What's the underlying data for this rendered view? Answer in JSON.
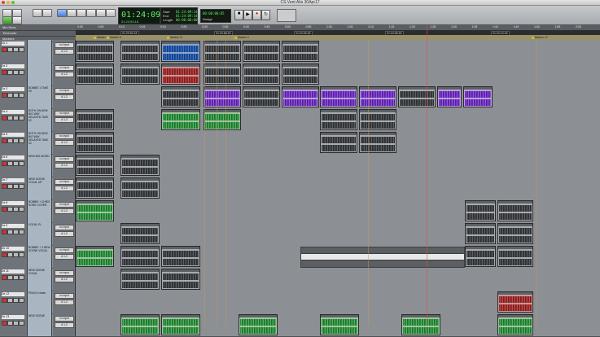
{
  "window": {
    "title": "CS Vent Alts 30Apr17"
  },
  "counter": {
    "main": "01:24:09:14",
    "sub": "01:23:53:18"
  },
  "selection": {
    "start_label": "Start",
    "end_label": "End",
    "length_label": "Length",
    "start": "01:24:09:14",
    "end": "01:24:09:14",
    "length": "00:00:00:00"
  },
  "nudge": {
    "value": "00:00:00:05",
    "label": "Nudge"
  },
  "ruler": {
    "rows": [
      "Min:Secs",
      "Timecode",
      "Markers"
    ],
    "ticks": [
      "0:00",
      "0:05",
      "0:10",
      "0:15",
      "0:20",
      "0:25",
      "0:30",
      "0:35",
      "0:40",
      "0:45",
      "0:50",
      "0:55",
      "1:00",
      "1:05",
      "1:10",
      "1:15",
      "1:20",
      "1:25",
      "1:30",
      "1:35",
      "1:40",
      "1:45",
      "1:50",
      "1:55",
      "2:00"
    ],
    "markers": [
      "Marker 4",
      "Marker 3",
      "Marker 11",
      "Marker 2",
      "Marker 12"
    ],
    "timecode_blocks": [
      "01:23:53:18",
      "01:23:58:18",
      "01:24:03:18",
      "01:24:08:18",
      "01:24:13:18"
    ]
  },
  "headers": {
    "comments": "Comments",
    "io": "I/O"
  },
  "tracks": [
    {
      "name": "Dx 1",
      "comment": "",
      "io": [
        "no input",
        "A 1-2"
      ]
    },
    {
      "name": "Dx 2",
      "comment": "",
      "io": [
        "no input",
        "A 1-2"
      ]
    },
    {
      "name": "Dx 3",
      "comment": "BOBBIE 1 TAKE 05",
      "io": [
        "no input",
        "A 1-2"
      ]
    },
    {
      "name": "Dx 4",
      "comment": "BOTH ON NEW BIG WAY DELAYED TAKE 02",
      "io": [
        "no input",
        "A 1-2"
      ]
    },
    {
      "name": "Dx 5",
      "comment": "BOTH ON NEW BIG WAY DELAYED TAKE 02",
      "io": [
        "no input",
        "A 1-2"
      ]
    },
    {
      "name": "Dx 6",
      "comment": "NEW BIG WORD",
      "io": [
        "no input",
        "A 1-2"
      ]
    },
    {
      "name": "Dx 7",
      "comment": "NEW SCENE VOCAL UP",
      "io": [
        "no input",
        "A 1-2"
      ]
    },
    {
      "name": "Dx 8",
      "comment": "BOBBIE + CHRIS SONG COVER",
      "io": [
        "no input",
        "A 1-2"
      ]
    },
    {
      "name": "Dx 9",
      "comment": "VOCAL PL",
      "io": [
        "no input",
        "A 1-2"
      ]
    },
    {
      "name": "Dx 10",
      "comment": "BOBBIE + 3 NEW SCENE VOCAL",
      "io": [
        "no input",
        "A 1-2"
      ]
    },
    {
      "name": "Dx 11",
      "comment": "NEW SCENE VOCAL",
      "io": [
        "no input",
        "A 1-2"
      ]
    },
    {
      "name": "Dx 12",
      "comment": "PEACH chase",
      "io": [
        "no input",
        "A 1-2"
      ]
    },
    {
      "name": "Dx 13",
      "comment": "NEW SCENE",
      "io": [
        "no input",
        "A 1-2"
      ]
    }
  ],
  "colors": {
    "blue": "#3d72c8",
    "red": "#c24848",
    "purple": "#9455dc",
    "green": "#4fb35d",
    "counter": "#5ff06a"
  }
}
